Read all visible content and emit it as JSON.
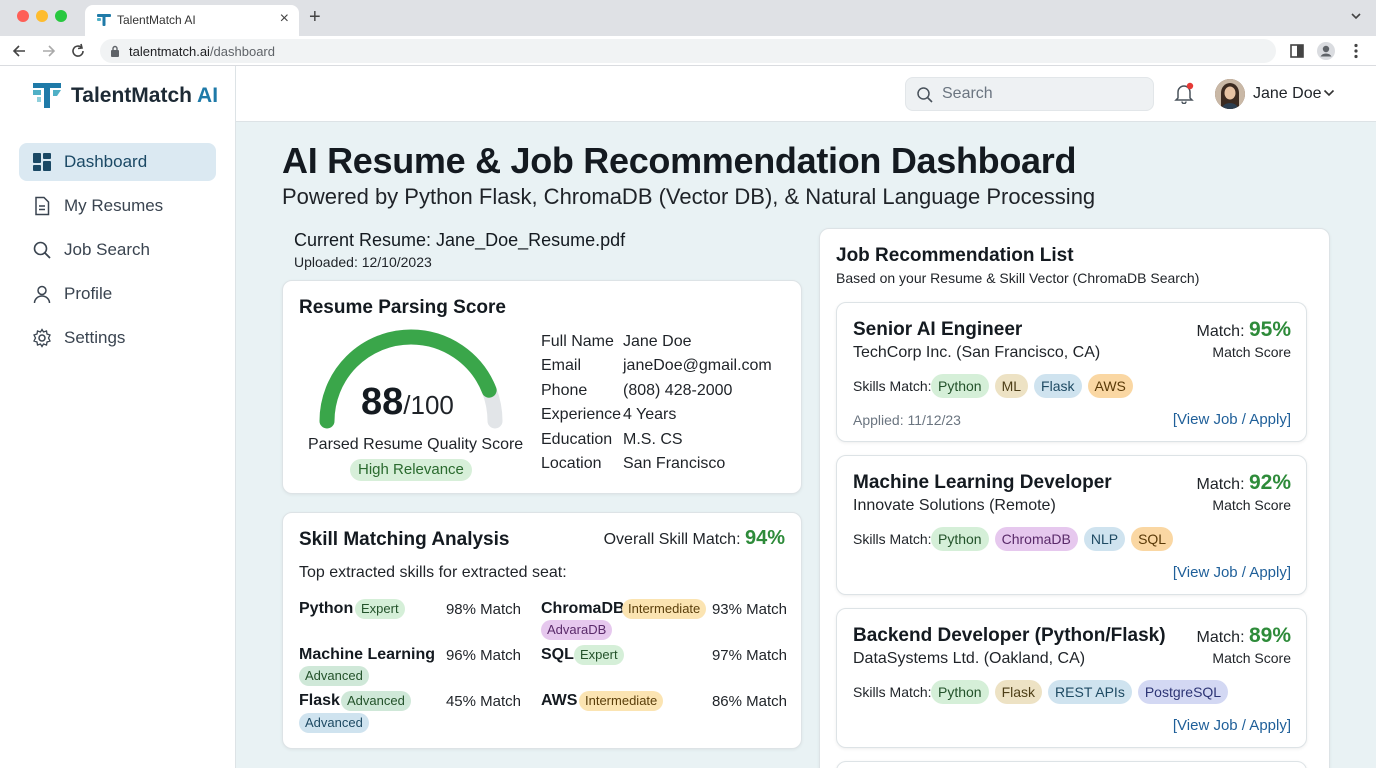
{
  "browser": {
    "tab_title": "TalentMatch AI",
    "url_domain": "talentmatch.ai",
    "url_path": "/dashboard"
  },
  "brand": {
    "name": "TalentMatch",
    "suffix": "AI"
  },
  "sidebar": {
    "items": [
      {
        "label": "Dashboard",
        "icon": "dashboard-icon",
        "active": true
      },
      {
        "label": "My Resumes",
        "icon": "document-icon"
      },
      {
        "label": "Job Search",
        "icon": "search-icon"
      },
      {
        "label": "Profile",
        "icon": "user-icon"
      },
      {
        "label": "Settings",
        "icon": "gear-icon"
      }
    ]
  },
  "topbar": {
    "search_placeholder": "Search",
    "user_name": "Jane Doe"
  },
  "page": {
    "title": "AI Resume & Job Recommendation Dashboard",
    "subtitle": "Powered by Python Flask, ChromaDB (Vector DB), & Natural Language Processing"
  },
  "resume": {
    "current": "Current Resume: Jane_Doe_Resume.pdf",
    "uploaded": "Uploaded: 12/10/2023"
  },
  "parsing": {
    "title": "Resume Parsing Score",
    "score": "88",
    "score_max": "/100",
    "score_fraction": 0.88,
    "caption": "Parsed Resume Quality Score",
    "relevance": "High Relevance",
    "fields": [
      {
        "label": "Full Name",
        "value": "Jane Doe"
      },
      {
        "label": "Email",
        "value": "janeDoe@gmail.com"
      },
      {
        "label": "Phone",
        "value": "(808) 428-2000"
      },
      {
        "label": "Experience",
        "value": "4 Years"
      },
      {
        "label": "Education",
        "value": "M.S. CS"
      },
      {
        "label": "Location",
        "value": "San Francisco"
      }
    ]
  },
  "skills": {
    "title": "Skill Matching Analysis",
    "overall_label": "Overall Skill Match:",
    "overall_pct": "94%",
    "intro": "Top extracted skills for extracted seat:",
    "items": [
      {
        "name": "Python",
        "badge": "Expert",
        "match": "98% Match"
      },
      {
        "name": "ChromaDB",
        "badge": "Intermediate",
        "badge2": "AdvaraDB",
        "match": "93% Match"
      },
      {
        "name": "Machine Learning",
        "badge": "Advanced",
        "match": "96% Match"
      },
      {
        "name": "SQL",
        "badge": "Expert",
        "match": "97% Match"
      },
      {
        "name": "Flask",
        "badge": "Advanced",
        "badge2": "Advanced",
        "match": "45% Match"
      },
      {
        "name": "AWS",
        "badge": "Intermediate",
        "match": "86% Match"
      }
    ]
  },
  "jobs": {
    "title": "Job Recommendation List",
    "subtitle": "Based on your Resume & Skill Vector (ChromaDB Search)",
    "match_label": "Match:",
    "match_score_label": "Match Score",
    "skills_label": "Skills Match:",
    "link_label": "[View Job / Apply]",
    "list": [
      {
        "title": "Senior AI Engineer",
        "company": "TechCorp Inc. (San Francisco, CA)",
        "match": "95%",
        "skills": [
          "Python",
          "ML",
          "Flask",
          "AWS"
        ],
        "applied": "Applied: 11/12/23"
      },
      {
        "title": "Machine Learning Developer",
        "company": "Innovate Solutions (Remote)",
        "match": "92%",
        "skills": [
          "Python",
          "ChromaDB",
          "NLP",
          "SQL"
        ]
      },
      {
        "title": "Backend Developer (Python/Flask)",
        "company": "DataSystems Ltd. (Oakland, CA)",
        "match": "89%",
        "skills": [
          "Python",
          "Flask",
          "REST APIs",
          "PostgreSQL"
        ]
      }
    ]
  },
  "colors": {
    "accent": "#1f7aa8",
    "success": "#2e8b3a",
    "gauge": "#3aa64a",
    "gauge_track": "#e2e5e8",
    "link": "#1f5f99"
  }
}
